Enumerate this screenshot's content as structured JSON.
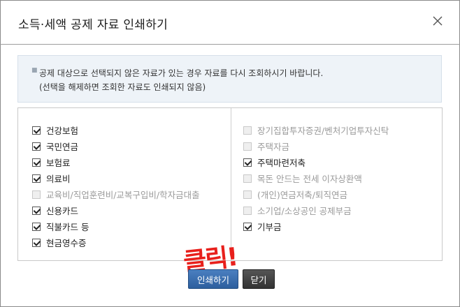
{
  "dialog": {
    "title": "소득·세액 공제 자료 인쇄하기",
    "close_icon": "close-icon"
  },
  "notice": {
    "bullet": "■",
    "line1": "공제 대상으로 선택되지 않은 자료가 있는 경우 자료를 다시 조회하시기 바랍니다.",
    "line2": "(선택을 해제하면 조회한 자료도 인쇄되지 않음)"
  },
  "options": {
    "left": [
      {
        "label": "건강보험",
        "checked": true,
        "disabled": false
      },
      {
        "label": "국민연금",
        "checked": true,
        "disabled": false
      },
      {
        "label": "보험료",
        "checked": true,
        "disabled": false
      },
      {
        "label": "의료비",
        "checked": true,
        "disabled": false
      },
      {
        "label": "교육비/직업훈련비/교복구입비/학자금대출",
        "checked": false,
        "disabled": true
      },
      {
        "label": "신용카드",
        "checked": true,
        "disabled": false
      },
      {
        "label": "직불카드 등",
        "checked": true,
        "disabled": false
      },
      {
        "label": "현금영수증",
        "checked": true,
        "disabled": false
      }
    ],
    "right": [
      {
        "label": "장기집합투자증권/벤처기업투자신탁",
        "checked": false,
        "disabled": true
      },
      {
        "label": "주택자금",
        "checked": false,
        "disabled": true
      },
      {
        "label": "주택마련저축",
        "checked": true,
        "disabled": false
      },
      {
        "label": "목돈 안드는 전세 이자상환액",
        "checked": false,
        "disabled": true
      },
      {
        "label": "(개인)연금저축/퇴직연금",
        "checked": false,
        "disabled": true
      },
      {
        "label": "소기업/소상공인 공제부금",
        "checked": false,
        "disabled": true
      },
      {
        "label": "기부금",
        "checked": true,
        "disabled": false
      }
    ]
  },
  "annotation": {
    "text": "클릭!",
    "color": "#e8201c"
  },
  "buttons": {
    "print_label": "인쇄하기",
    "close_label": "닫기"
  }
}
